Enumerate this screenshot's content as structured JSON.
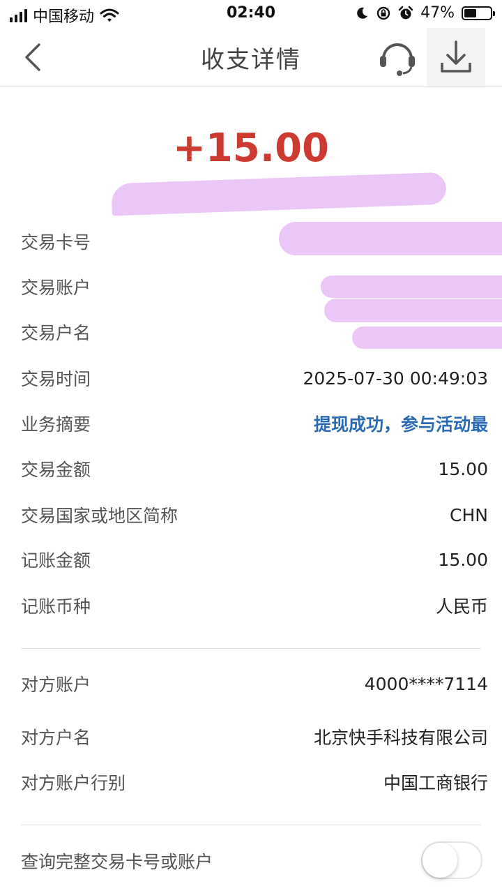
{
  "status": {
    "carrier": "中国移动",
    "time": "02:40",
    "battery_text": "47%",
    "battery_level": 0.47
  },
  "nav": {
    "title": "收支详情"
  },
  "amount": "+15.00",
  "details": [
    {
      "label": "交易卡号",
      "value": ""
    },
    {
      "label": "交易账户",
      "value": ""
    },
    {
      "label": "交易户名",
      "value": ""
    },
    {
      "label": "交易时间",
      "value": "2025-07-30 00:49:03"
    },
    {
      "label": "业务摘要",
      "value": "提现成功，参与活动最"
    },
    {
      "label": "交易金额",
      "value": "15.00"
    },
    {
      "label": "交易国家或地区简称",
      "value": "CHN"
    },
    {
      "label": "记账金额",
      "value": "15.00"
    },
    {
      "label": "记账币种",
      "value": "人民币"
    }
  ],
  "counterparty": [
    {
      "label": "对方账户",
      "value": "4000****7114"
    },
    {
      "label": "对方户名",
      "value": "北京快手科技有限公司"
    },
    {
      "label": "对方账户行别",
      "value": "中国工商银行"
    }
  ],
  "query": {
    "label": "查询完整交易卡号或账户",
    "enabled": false
  },
  "colors": {
    "amount": "#cc3b32",
    "link": "#2c6bb3",
    "redaction": "#eac7f6"
  }
}
